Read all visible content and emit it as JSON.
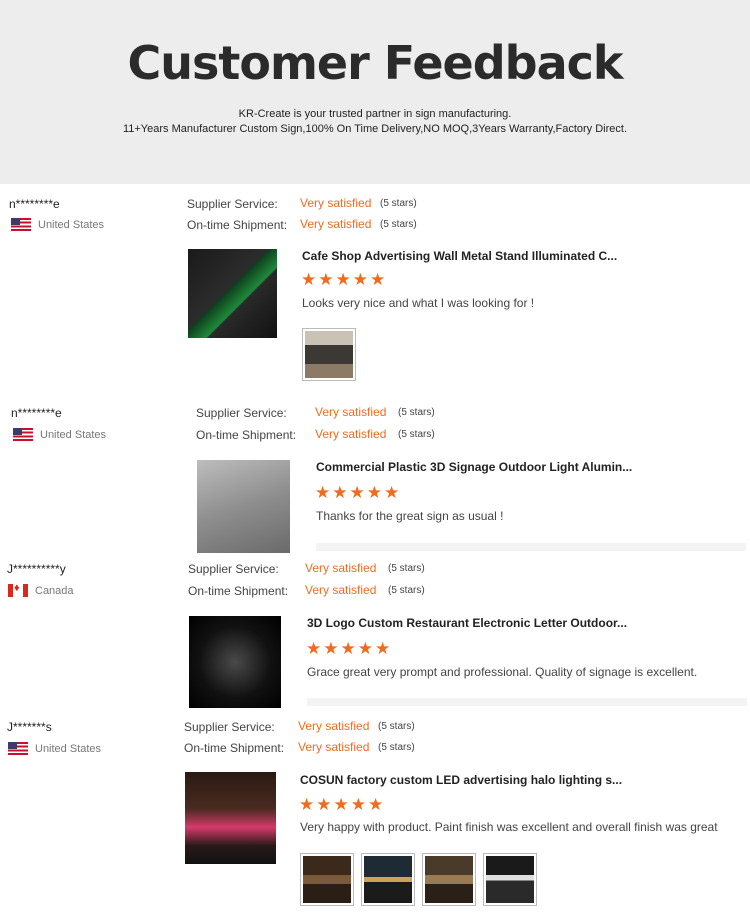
{
  "header": {
    "title": "Customer Feedback",
    "line1": "KR-Create is your trusted partner in sign manufacturing.",
    "line2": "11+Years Manufacturer Custom Sign,100% On Time Delivery,NO MOQ,3Years Warranty,Factory Direct."
  },
  "labels": {
    "supplier": "Supplier Service:",
    "shipment": "On-time Shipment:"
  },
  "colors": {
    "accent": "#f26b1d",
    "header_bg": "#ededed"
  },
  "reviews": [
    {
      "user": "n********e",
      "country": "United States",
      "flag": "us-flag-icon",
      "supplier_rating": "Very satisfied",
      "supplier_stars": "(5 stars)",
      "shipment_rating": "Very satisfied",
      "shipment_stars": "(5 stars)",
      "product_title": "Cafe Shop Advertising Wall Metal Stand Illuminated C...",
      "rating": 5,
      "stars": "★★★★★",
      "comment": "Looks very nice and what I was looking for !",
      "photo_count": 1
    },
    {
      "user": "n********e",
      "country": "United States",
      "flag": "us-flag-icon",
      "supplier_rating": "Very satisfied",
      "supplier_stars": "(5 stars)",
      "shipment_rating": "Very satisfied",
      "shipment_stars": "(5 stars)",
      "product_title": "Commercial Plastic 3D Signage Outdoor Light Alumin...",
      "rating": 5,
      "stars": "★★★★★",
      "comment": "Thanks for the great sign as usual !",
      "photo_count": 0
    },
    {
      "user": "J**********y",
      "country": "Canada",
      "flag": "canada-flag-icon",
      "supplier_rating": "Very satisfied",
      "supplier_stars": "(5 stars)",
      "shipment_rating": "Very satisfied",
      "shipment_stars": "(5 stars)",
      "product_title": "3D Logo Custom Restaurant Electronic Letter Outdoor...",
      "rating": 5,
      "stars": "★★★★★",
      "comment": "Grace great very prompt and professional.   Quality of signage is excellent.",
      "photo_count": 0
    },
    {
      "user": "J*******s",
      "country": "United States",
      "flag": "us-flag-icon",
      "supplier_rating": "Very satisfied",
      "supplier_stars": "(5 stars)",
      "shipment_rating": "Very satisfied",
      "shipment_stars": "(5 stars)",
      "product_title": "COSUN factory custom LED advertising halo lighting s...",
      "rating": 5,
      "stars": "★★★★★",
      "comment": "Very happy with product. Paint finish was excellent and overall finish was great",
      "photo_count": 4
    }
  ]
}
